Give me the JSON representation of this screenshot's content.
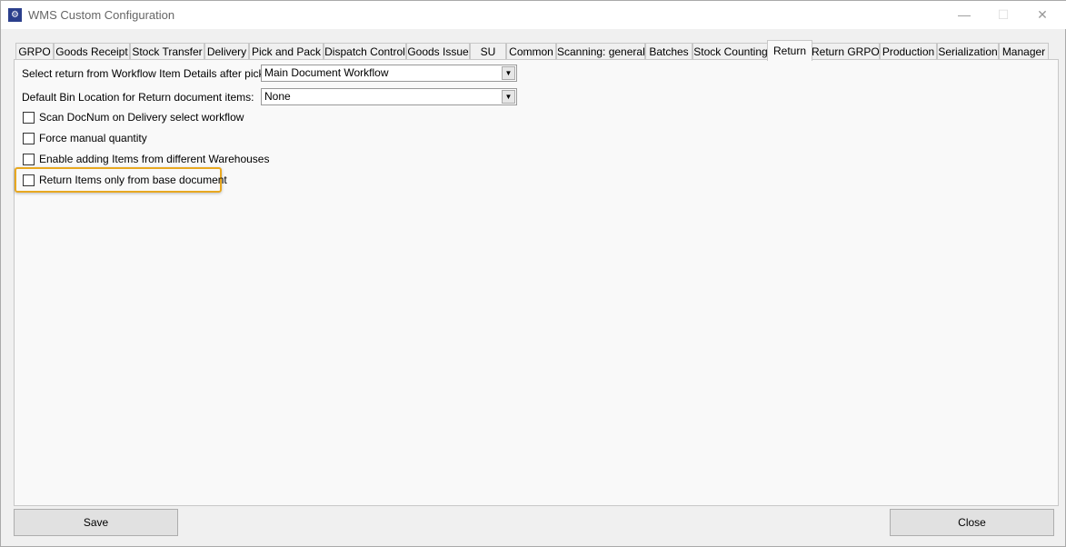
{
  "window": {
    "title": "WMS Custom Configuration",
    "icon": "gear-icon"
  },
  "tabs": [
    "GRPO",
    "Goods Receipt",
    "Stock Transfer",
    "Delivery",
    "Pick and Pack",
    "Dispatch Control",
    "Goods Issue",
    "SU",
    "Common",
    "Scanning: general",
    "Batches",
    "Stock Counting",
    "Return",
    "Return GRPO",
    "Production",
    "Serialization",
    "Manager"
  ],
  "active_tab": "Return",
  "fields": {
    "workflow_label": "Select return from Workflow Item Details after pick",
    "workflow_value": "Main Document Workflow",
    "bin_label": "Default Bin Location for Return document items:",
    "bin_value": "None"
  },
  "checkboxes": [
    {
      "label": "Scan DocNum on Delivery select workflow",
      "checked": false
    },
    {
      "label": "Force manual quantity",
      "checked": false
    },
    {
      "label": "Enable adding Items from different Warehouses",
      "checked": false
    },
    {
      "label": "Return Items only from base document",
      "checked": false,
      "highlighted": true
    }
  ],
  "highlight_color": "#e8a820",
  "buttons": {
    "save": "Save",
    "close": "Close"
  }
}
